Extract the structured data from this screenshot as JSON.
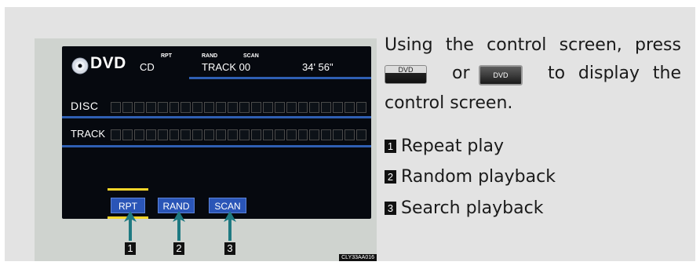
{
  "screen": {
    "logo_text": "DVD",
    "indicators": {
      "rpt": "RPT",
      "rand": "RAND",
      "scan": "SCAN"
    },
    "source": "CD",
    "track_number": "TRACK 00",
    "elapsed_time": "34' 56\"",
    "disc_label": "DISC",
    "track_label": "TRACK",
    "buttons": {
      "rpt": "RPT",
      "rand": "RAND",
      "scan": "SCAN"
    }
  },
  "callouts": [
    "1",
    "2",
    "3"
  ],
  "figure_code": "CLY33AA016",
  "description": {
    "line1": "Using the control screen, press",
    "button_a": "DVD",
    "or_word": "or",
    "button_b": "DVD",
    "to_display": "to display the",
    "line3": "control screen."
  },
  "items": [
    {
      "num": "1",
      "label": "Repeat play"
    },
    {
      "num": "2",
      "label": "Random playback"
    },
    {
      "num": "3",
      "label": "Search playback"
    }
  ],
  "colors": {
    "panel_bg": "#e3e3e3",
    "screen_bg": "#06090f",
    "accent_line": "#2f5fb3",
    "button_blue": "#2a55b7",
    "highlight_yellow": "#f5d52a",
    "callout_arrow": "#1f7a82"
  }
}
